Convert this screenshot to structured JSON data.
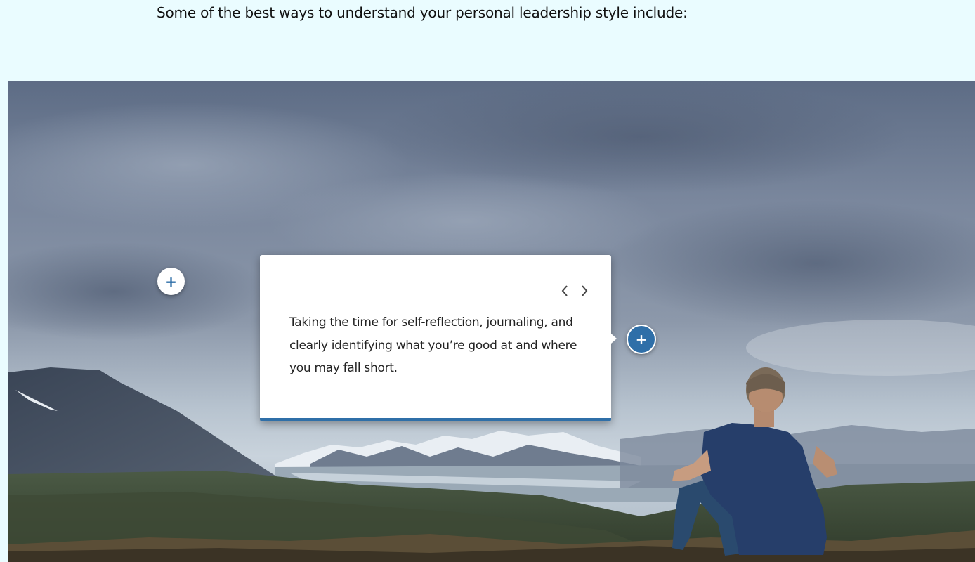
{
  "intro_text": "Some of the best ways to understand your personal leadership style include:",
  "hotspots": [
    {
      "icon": "plus",
      "label": "+",
      "state": "collapsed"
    },
    {
      "icon": "plus",
      "label": "+",
      "state": "active"
    }
  ],
  "popup": {
    "body": "Taking the time for self-reflection, journaling, and clearly identifying what you’re good at and where you may fall short.",
    "prev_icon": "chevron-left-icon",
    "next_icon": "chevron-right-icon"
  },
  "colors": {
    "page_background": "#eafcff",
    "accent": "#2f6fa8",
    "popup_background": "#ffffff"
  }
}
